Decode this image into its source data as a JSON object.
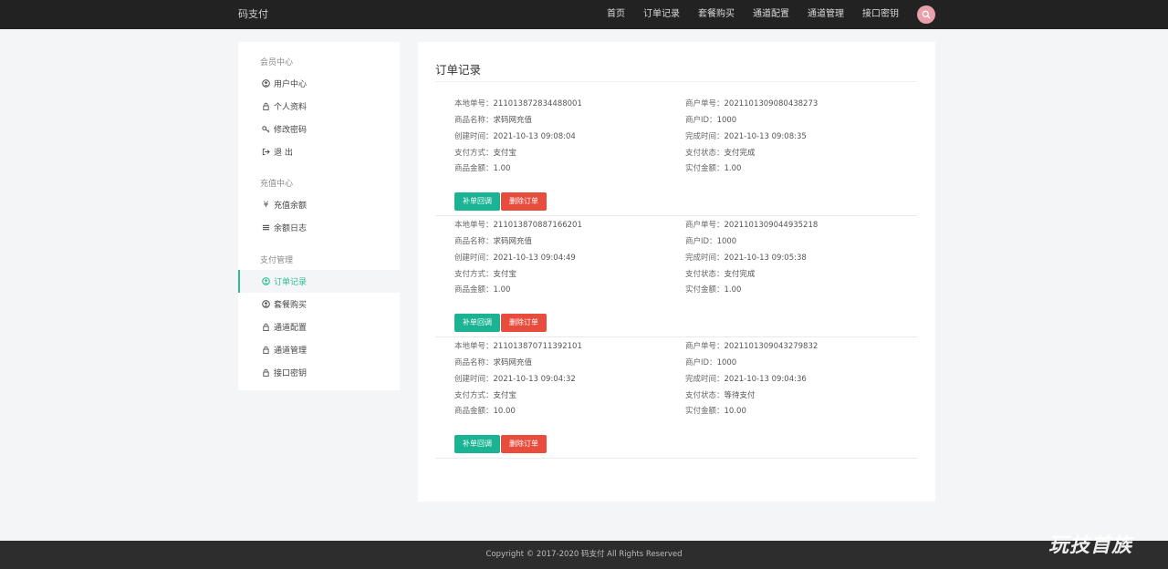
{
  "brand": "码支付",
  "nav": [
    "首页",
    "订单记录",
    "套餐购买",
    "通道配置",
    "通道管理",
    "接口密钥"
  ],
  "colors": {
    "accent": "#2dbe8c",
    "green_button": "#1ab394",
    "red_button": "#e74c3c",
    "avatar": "#e8a1ab"
  },
  "sidebar": {
    "sections": [
      {
        "title": "会员中心",
        "items": [
          {
            "label": "用户中心",
            "icon": "user-circle-icon"
          },
          {
            "label": "个人资料",
            "icon": "lock-icon"
          },
          {
            "label": "修改密码",
            "icon": "key-icon"
          },
          {
            "label": "退 出",
            "icon": "sign-out-icon"
          }
        ]
      },
      {
        "title": "充值中心",
        "items": [
          {
            "label": "充值余额",
            "icon": "yen-icon"
          },
          {
            "label": "余额日志",
            "icon": "list-icon"
          }
        ]
      },
      {
        "title": "支付管理",
        "items": [
          {
            "label": "订单记录",
            "icon": "user-circle-icon",
            "active": true
          },
          {
            "label": "套餐购买",
            "icon": "user-circle-icon"
          },
          {
            "label": "通道配置",
            "icon": "lock-icon"
          },
          {
            "label": "通道管理",
            "icon": "lock-icon"
          },
          {
            "label": "接口密钥",
            "icon": "lock-icon"
          }
        ]
      }
    ]
  },
  "main": {
    "title": "订单记录",
    "labels": {
      "local_no": "本地单号：",
      "merchant_no": "商户单号：",
      "product": "商品名称：",
      "merchant_id": "商户ID：",
      "created": "创建时间：",
      "completed": "完成时间：",
      "pay_method": "支付方式：",
      "pay_status": "支付状态：",
      "amount": "商品金额：",
      "paid": "实付金额："
    },
    "buttons": {
      "callback": "补单回调",
      "delete": "删除订单"
    },
    "orders": [
      {
        "local_no": "211013872834488001",
        "merchant_no": "2021101309080438273",
        "product": "求码网充值",
        "merchant_id": "1000",
        "created": "2021-10-13 09:08:04",
        "completed": "2021-10-13 09:08:35",
        "pay_method": "支付宝",
        "pay_status": "支付完成",
        "amount": "1.00",
        "paid": "1.00"
      },
      {
        "local_no": "211013870887166201",
        "merchant_no": "2021101309044935218",
        "product": "求码网充值",
        "merchant_id": "1000",
        "created": "2021-10-13 09:04:49",
        "completed": "2021-10-13 09:05:38",
        "pay_method": "支付宝",
        "pay_status": "支付完成",
        "amount": "1.00",
        "paid": "1.00"
      },
      {
        "local_no": "211013870711392101",
        "merchant_no": "2021101309043279832",
        "product": "求码网充值",
        "merchant_id": "1000",
        "created": "2021-10-13 09:04:32",
        "completed": "2021-10-13 09:04:36",
        "pay_method": "支付宝",
        "pay_status": "等待支付",
        "amount": "10.00",
        "paid": "10.00"
      }
    ]
  },
  "footer": {
    "copyright": "Copyright © 2017-2020 码支付 All Rights Reserved"
  },
  "watermark": "玩技首族"
}
